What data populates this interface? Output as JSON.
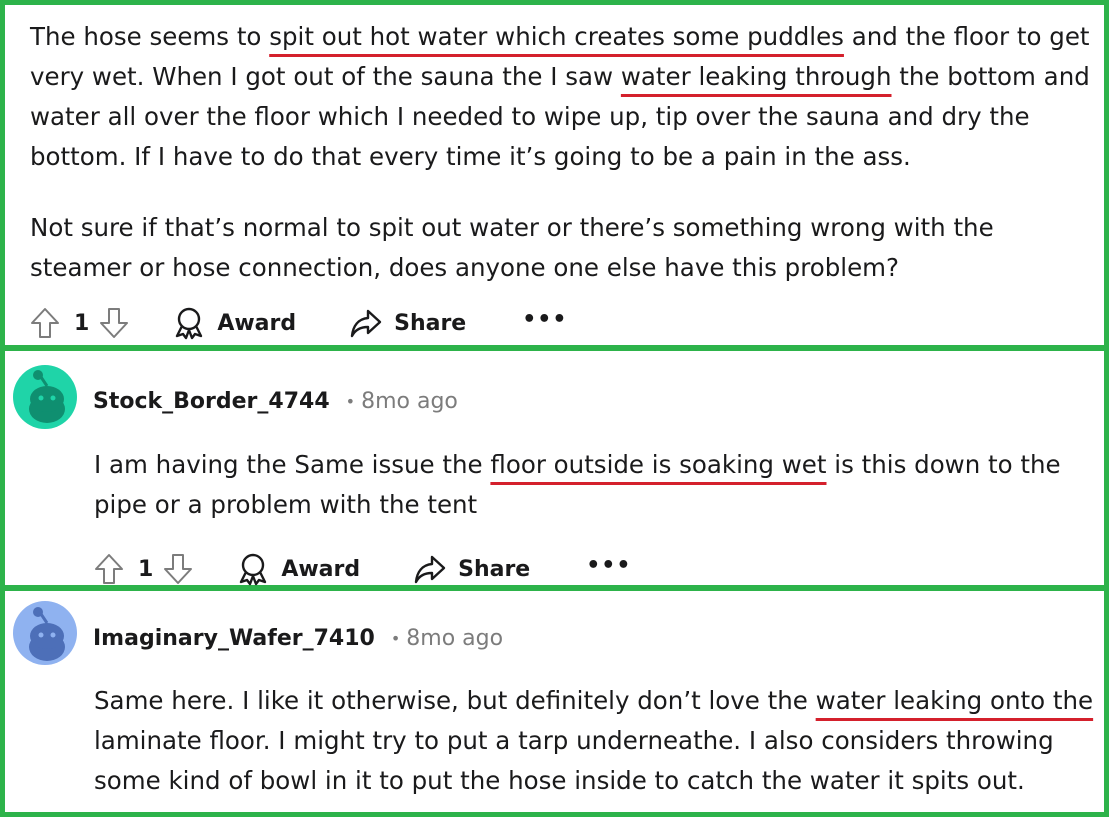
{
  "post": {
    "paragraph1": {
      "lines": [
        [
          {
            "t": "The hose seems to "
          },
          {
            "t": "spit out hot water which creates some puddles",
            "u": true
          },
          {
            "t": " and the floor to get"
          }
        ],
        [
          {
            "t": "very wet. When I got out of the sauna the I saw "
          },
          {
            "t": "water leaking through",
            "u": true
          },
          {
            "t": " the bottom and"
          }
        ],
        [
          {
            "t": "water all over the floor which I needed to wipe up, tip over the sauna and dry the"
          }
        ],
        [
          {
            "t": "bottom. If I have to do that every time it’s going to be a pain in the ass."
          }
        ]
      ]
    },
    "paragraph2": {
      "lines": [
        [
          {
            "t": "Not sure if that’s normal to spit out water or there’s something wrong with the"
          }
        ],
        [
          {
            "t": "steamer or hose connection, does anyone one else have this problem?"
          }
        ]
      ]
    },
    "actions": {
      "votes": "1",
      "award_label": "Award",
      "share_label": "Share",
      "more_label": "•••"
    }
  },
  "comments": [
    {
      "username": "Stock_Border_4744",
      "separator": "•",
      "time": "8mo ago",
      "avatar_color": "#1fd4a8",
      "lines": [
        [
          {
            "t": "I am having the Same issue the "
          },
          {
            "t": "floor outside is soaking wet",
            "u": true
          },
          {
            "t": " is this down to the"
          }
        ],
        [
          {
            "t": "pipe or a problem with the tent"
          }
        ]
      ],
      "actions": {
        "votes": "1",
        "award_label": "Award",
        "share_label": "Share",
        "more_label": "•••"
      }
    },
    {
      "username": "Imaginary_Wafer_7410",
      "separator": "•",
      "time": "8mo ago",
      "avatar_color": "#8fb2f0",
      "lines": [
        [
          {
            "t": "Same here. I like it otherwise, but definitely don’t love the "
          },
          {
            "t": "water leaking onto the",
            "u": true
          }
        ],
        [
          {
            "t": "laminate floor. I might try to put a tarp underneathe. I also considers throwing"
          }
        ],
        [
          {
            "t": "some kind of bowl in it to put the hose inside to catch the water it spits out."
          }
        ]
      ]
    }
  ],
  "colors": {
    "frame": "#2db34a",
    "underline": "#d4202c",
    "meta": "#7c7c7c"
  },
  "icons": [
    "upvote-icon",
    "downvote-icon",
    "award-icon",
    "share-icon",
    "more-icon",
    "avatar"
  ]
}
